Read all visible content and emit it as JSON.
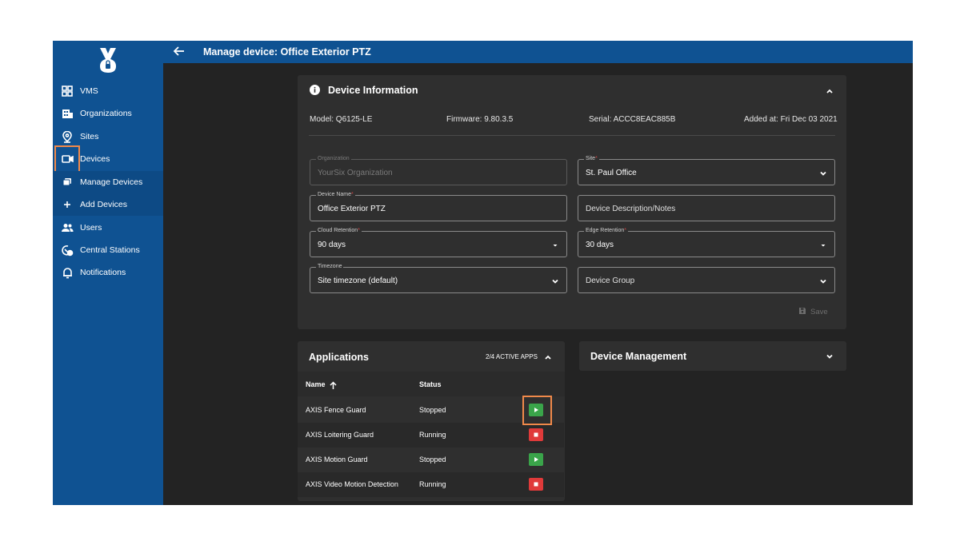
{
  "colors": {
    "brand_blue": "#0f5292",
    "background": "#232323",
    "card": "#2f2f2f",
    "play_green": "#3aa44a",
    "stop_red": "#e03a3a",
    "highlight_orange": "#f0894a"
  },
  "header": {
    "back_icon": "arrow-left-icon",
    "title": "Manage device: Office Exterior PTZ"
  },
  "sidebar": {
    "logo_icon": "yoursix-logo-icon",
    "items": [
      {
        "label": "VMS",
        "icon": "grid-icon"
      },
      {
        "label": "Organizations",
        "icon": "building-icon"
      },
      {
        "label": "Sites",
        "icon": "location-pin-icon"
      },
      {
        "label": "Devices",
        "icon": "camera-icon"
      },
      {
        "label": "Manage Devices",
        "icon": "stack-icon"
      },
      {
        "label": "Add Devices",
        "icon": "plus-icon"
      },
      {
        "label": "Users",
        "icon": "users-icon"
      },
      {
        "label": "Central Stations",
        "icon": "station-icon"
      },
      {
        "label": "Notifications",
        "icon": "bell-icon"
      }
    ]
  },
  "device_info": {
    "title": "Device Information",
    "model": "Model: Q6125-LE",
    "firmware": "Firmware: 9.80.3.5",
    "serial": "Serial: ACCC8EAC885B",
    "added": "Added at: Fri Dec 03 2021",
    "fields": {
      "organization": {
        "label": "Organization",
        "value": "YourSix Organization"
      },
      "site": {
        "label": "Site",
        "required": "*",
        "value": "St. Paul Office"
      },
      "device_name": {
        "label": "Device Name",
        "required": "*",
        "value": "Office Exterior PTZ"
      },
      "description": {
        "placeholder": "Device Description/Notes"
      },
      "cloud_retention": {
        "label": "Cloud Retention",
        "required": "*",
        "value": "90 days"
      },
      "edge_retention": {
        "label": "Edge Retention",
        "required": "*",
        "value": "30 days"
      },
      "timezone": {
        "label": "Timezone",
        "value": "Site timezone (default)"
      },
      "device_group": {
        "placeholder": "Device Group"
      }
    },
    "save_label": "Save"
  },
  "applications": {
    "title": "Applications",
    "active_apps": "2/4 ACTIVE APPS",
    "columns": {
      "name": "Name",
      "status": "Status"
    },
    "rows": [
      {
        "name": "AXIS Fence Guard",
        "status": "Stopped",
        "action": "play"
      },
      {
        "name": "AXIS Loitering Guard",
        "status": "Running",
        "action": "stop"
      },
      {
        "name": "AXIS Motion Guard",
        "status": "Stopped",
        "action": "play"
      },
      {
        "name": "AXIS Video Motion Detection",
        "status": "Running",
        "action": "stop"
      }
    ]
  },
  "device_management": {
    "title": "Device Management"
  }
}
